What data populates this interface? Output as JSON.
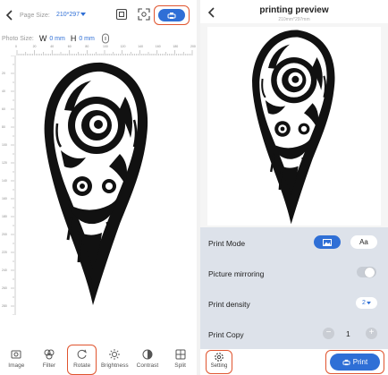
{
  "left": {
    "toolbar": {
      "page_size_label": "Page Size:",
      "page_size_value": "210*297"
    },
    "photo_size": {
      "label": "Photo Size:",
      "w_label": "W",
      "w_value": "0 mm",
      "h_label": "H",
      "h_value": "0 mm"
    },
    "ruler_top": [
      "0",
      "20",
      "40",
      "60",
      "80",
      "100",
      "120",
      "140",
      "160",
      "180",
      "200"
    ],
    "ruler_left": [
      "20",
      "40",
      "60",
      "80",
      "100",
      "120",
      "140",
      "160",
      "180",
      "200",
      "220",
      "240",
      "260",
      "280"
    ],
    "bottom_tools": [
      {
        "label": "Image",
        "icon": "image-icon"
      },
      {
        "label": "Filter",
        "icon": "filter-icon"
      },
      {
        "label": "Rotate",
        "icon": "rotate-icon"
      },
      {
        "label": "Brightness",
        "icon": "brightness-icon"
      },
      {
        "label": "Contrast",
        "icon": "contrast-icon"
      },
      {
        "label": "Split",
        "icon": "split-icon"
      }
    ]
  },
  "right": {
    "title": "printing preview",
    "subtitle": "210mm*297mm",
    "settings": {
      "print_mode": {
        "label": "Print Mode",
        "text_option": "Aa"
      },
      "mirroring": {
        "label": "Picture mirroring"
      },
      "density": {
        "label": "Print density",
        "value": "2"
      },
      "copy": {
        "label": "Print Copy",
        "minus": "−",
        "value": "1",
        "plus": "+"
      }
    },
    "footer": {
      "setting_label": "Setting",
      "print_label": "Print"
    }
  },
  "colors": {
    "accent": "#2f6fd6",
    "highlight": "#e0542e"
  }
}
